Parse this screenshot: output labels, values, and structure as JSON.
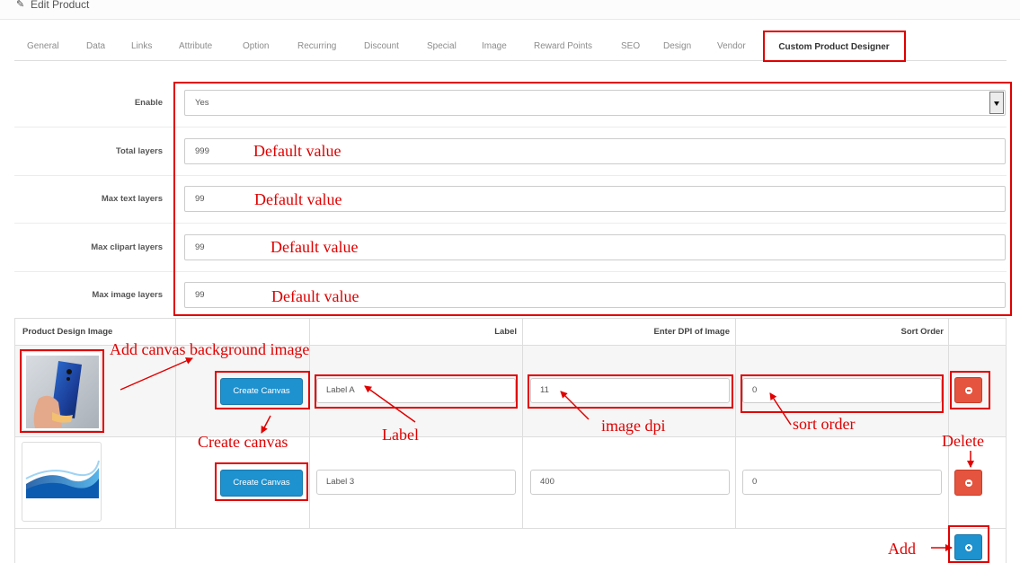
{
  "panel": {
    "title": "Edit Product"
  },
  "tabs": [
    {
      "label": "General"
    },
    {
      "label": "Data"
    },
    {
      "label": "Links"
    },
    {
      "label": "Attribute"
    },
    {
      "label": "Option"
    },
    {
      "label": "Recurring"
    },
    {
      "label": "Discount"
    },
    {
      "label": "Special"
    },
    {
      "label": "Image"
    },
    {
      "label": "Reward Points"
    },
    {
      "label": "SEO"
    },
    {
      "label": "Design"
    },
    {
      "label": "Vendor"
    },
    {
      "label": "Custom Product Designer"
    }
  ],
  "form": {
    "enable": {
      "label": "Enable",
      "value": "Yes"
    },
    "total_layers": {
      "label": "Total layers",
      "value": "999"
    },
    "max_text_layers": {
      "label": "Max text layers",
      "value": "99"
    },
    "max_clipart_layers": {
      "label": "Max clipart layers",
      "value": "99"
    },
    "max_image_layers": {
      "label": "Max image layers",
      "value": "99"
    }
  },
  "table": {
    "headers": {
      "image": "Product Design Image",
      "label": "Label",
      "dpi": "Enter DPI of Image",
      "sort": "Sort Order"
    },
    "rows": [
      {
        "button": "Create Canvas",
        "label": "Label A",
        "dpi": "11",
        "sort": "0"
      },
      {
        "button": "Create Canvas",
        "label": "Label 3",
        "dpi": "400",
        "sort": "0"
      }
    ]
  },
  "annotations": {
    "default1": "Default value",
    "default2": "Default value",
    "default3": "Default value",
    "default4": "Default value",
    "add_bg": "Add canvas background image",
    "create_canvas": "Create canvas",
    "label": "Label",
    "image_dpi": "image dpi",
    "sort_order": "sort order",
    "delete": "Delete",
    "add": "Add"
  },
  "colors": {
    "primary": "#1e91cf",
    "danger": "#e4543e",
    "annotation": "#e00000"
  }
}
